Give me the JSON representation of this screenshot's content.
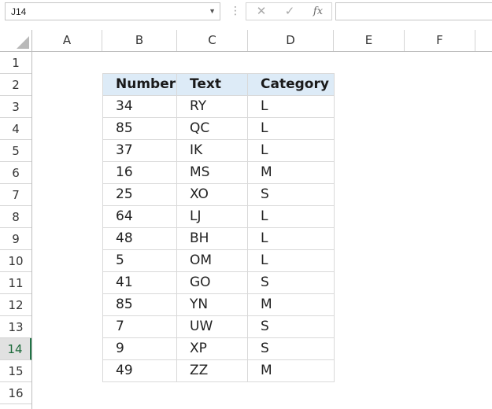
{
  "formula_bar": {
    "name_box": "J14",
    "separator": "⋮",
    "cancel_symbol": "✕",
    "confirm_symbol": "✓",
    "function_symbol": "fx",
    "formula_value": ""
  },
  "columns": [
    "A",
    "B",
    "C",
    "D",
    "E",
    "F"
  ],
  "rows": [
    "1",
    "2",
    "3",
    "4",
    "5",
    "6",
    "7",
    "8",
    "9",
    "10",
    "11",
    "12",
    "13",
    "14",
    "15",
    "16"
  ],
  "active_row": "14",
  "table": {
    "headers": [
      "Number",
      "Text",
      "Category"
    ],
    "rows": [
      [
        "34",
        "RY",
        "L"
      ],
      [
        "85",
        "QC",
        "L"
      ],
      [
        "37",
        "IK",
        "L"
      ],
      [
        "16",
        "MS",
        "M"
      ],
      [
        "25",
        "XO",
        "S"
      ],
      [
        "64",
        "LJ",
        "L"
      ],
      [
        "48",
        "BH",
        "L"
      ],
      [
        "5",
        "OM",
        "L"
      ],
      [
        "41",
        "GO",
        "S"
      ],
      [
        "85",
        "YN",
        "M"
      ],
      [
        "7",
        "UW",
        "S"
      ],
      [
        "9",
        "XP",
        "S"
      ],
      [
        "49",
        "ZZ",
        "M"
      ]
    ]
  },
  "colors": {
    "header_fill": "#ddebf7",
    "active_accent": "#217346"
  }
}
